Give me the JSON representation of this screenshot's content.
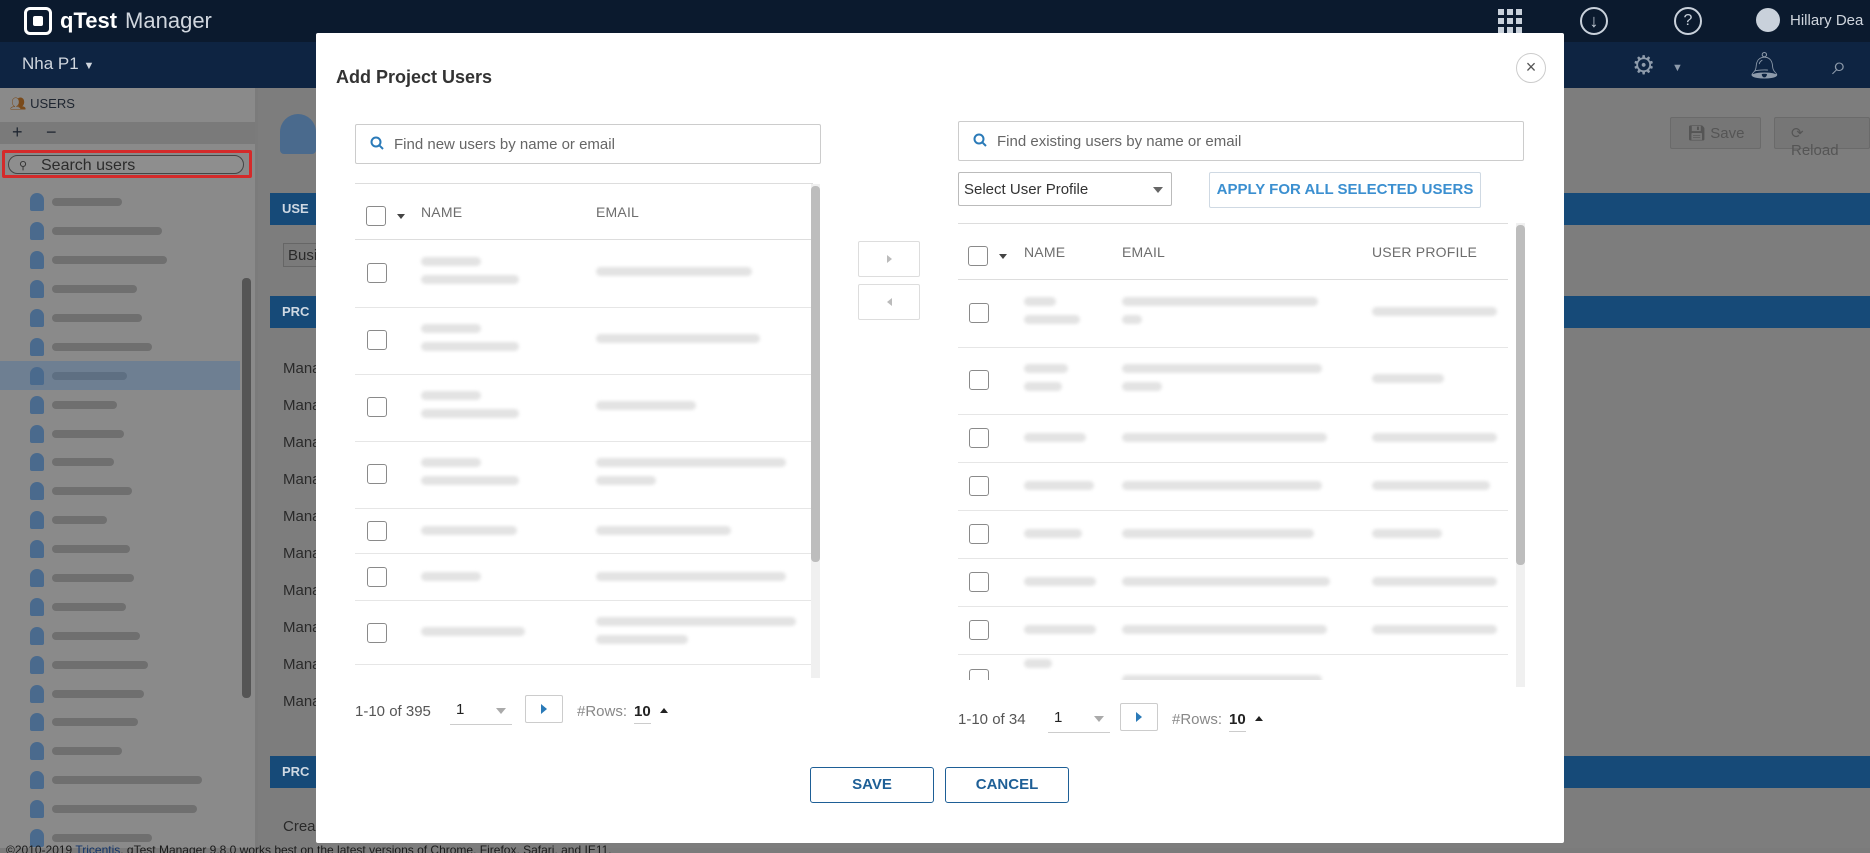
{
  "app": {
    "brand": "qTest",
    "product": "Manager",
    "user_name": "Hillary Dea"
  },
  "nav": {
    "project": "Nha P1"
  },
  "left_panel": {
    "title": "USERS",
    "add": "+",
    "remove": "−",
    "search_placeholder": "Search users"
  },
  "background": {
    "save_label": "Save",
    "reload_label": "Reload",
    "section_1": "USE",
    "section_2": "PRC",
    "section_3": "PRC",
    "busi": "Busi",
    "mana": "Mana",
    "crea": "Crea"
  },
  "footer": {
    "copyright": "©2010-2019 ",
    "company": "Tricentis",
    "note": ". qTest Manager 9.8.0 works best on the latest versions of Chrome, Firefox, Safari, and IE11."
  },
  "modal": {
    "title": "Add Project Users",
    "close": "×",
    "new_users": {
      "search_placeholder": "Find new users by name or email",
      "columns": {
        "name": "NAME",
        "email": "EMAIL"
      },
      "pager": {
        "count": "1-10 of 395",
        "page": "1",
        "rows_label": "#Rows:",
        "rows": "10"
      }
    },
    "existing_users": {
      "search_placeholder": "Find existing users by name or email",
      "profile_select": "Select User Profile",
      "apply_label": "APPLY FOR ALL SELECTED USERS",
      "columns": {
        "name": "NAME",
        "email": "EMAIL",
        "profile": "USER PROFILE"
      },
      "pager": {
        "count": "1-10 of 34",
        "page": "1",
        "rows_label": "#Rows:",
        "rows": "10"
      }
    },
    "save_label": "SAVE",
    "cancel_label": "CANCEL"
  },
  "colors": {
    "topbar": "#0b1a2e",
    "navbar": "#0e2442",
    "accent": "#1e5f96",
    "link": "#3b8fd0",
    "highlight": "#d42a2a"
  }
}
